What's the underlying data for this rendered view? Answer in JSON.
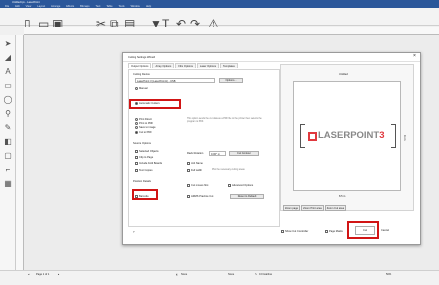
{
  "window": {
    "title": "Untitled.lpx - LaserPoint",
    "menus": [
      "File",
      "Edit",
      "View",
      "Layout",
      "Arrange",
      "Effects",
      "Bitmaps",
      "Text",
      "Table",
      "Tools",
      "Window",
      "Help"
    ]
  },
  "dialog": {
    "title": "Cutting Settings Wizard",
    "close_glyph": "×",
    "tabs": [
      "Output Options",
      "Array Options",
      "Film Options",
      "Laser Options",
      "Templates"
    ],
    "cutting_device_label": "Cutting Device",
    "device_value": "LaserPoint 3 (LaserPoint1) - USB",
    "preferences_button": "Options...",
    "manual_label": "Manual",
    "automatic_label": "Automatic Cutters",
    "output_options": [
      "Print Direct",
      "Print to PDF",
      "Save to image",
      "Cut to PDF"
    ],
    "output_hint": "This option sends the cut data as a PDF file to the printer then selects the program to PDF.",
    "source_label": "Source Options",
    "source_checks": [
      "Selected Objects",
      "Clip to Page",
      "Include Fold Boards",
      "Text Copies"
    ],
    "rotation_label": "Rack Rotation",
    "rotation_value": "0.00° m",
    "cut_contour_button": "Cut Contour",
    "mid_checks": [
      "Job Name",
      "Full width"
    ],
    "full_width_hint": "Plot the necessary cutting areas",
    "position_label": "Position Details",
    "position_sub": "Cut moves first",
    "advanced_label": "Advanced Options",
    "barcode_label": "Barcode",
    "mark_label": "ARMS Practice Cut",
    "reset_button": "Reset to Default",
    "preview_title": "Untitled",
    "preview_width": "8.5 in",
    "preview_height": "11 in",
    "brand_name": "LASERPOINT",
    "brand_number": "3",
    "zoom_buttons": [
      "Zoom page",
      "Zoom Print area",
      "Zoom Cut area"
    ],
    "show_controller_label": "Show Cut Controller",
    "page_marks_label": "Page Marks",
    "cut_button": "Cut",
    "cancel_button": "Cancel",
    "help_glyph": "?"
  },
  "status": {
    "page_info": "Page 1 of 1",
    "fill_label": "None",
    "outline_label": "None",
    "size_label": "0.0 Hairline",
    "zoom_value": "50%"
  },
  "colors": {
    "accent_red": "#d11515",
    "title_blue": "#2b579a",
    "brand_red": "#e0393e"
  }
}
